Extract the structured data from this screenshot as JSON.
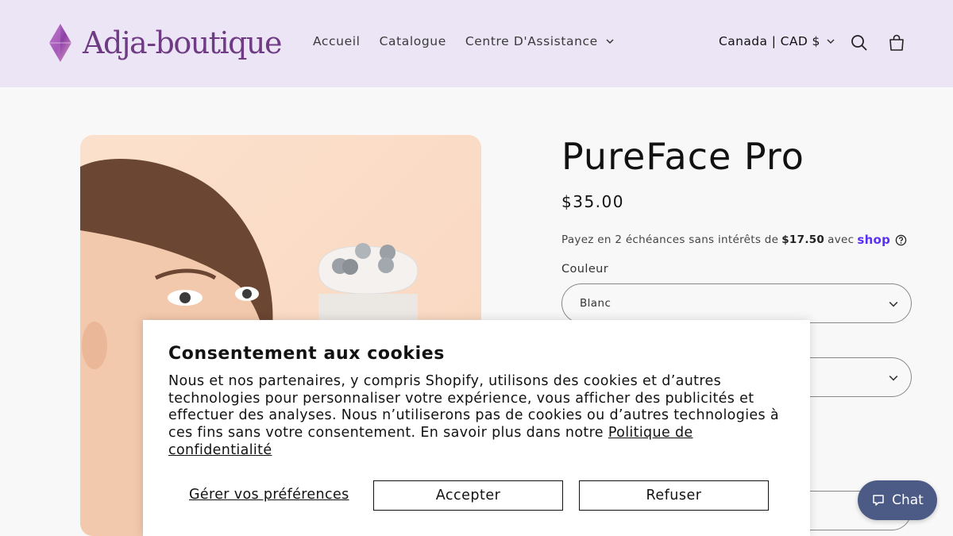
{
  "header": {
    "brand": "Adja-boutique",
    "nav": [
      {
        "label": "Accueil"
      },
      {
        "label": "Catalogue"
      },
      {
        "label": "Centre D'Assistance"
      }
    ],
    "country_selector": "Canada | CAD $",
    "icons": {
      "search": "search-icon",
      "cart": "cart-icon",
      "logo": "diamond-logo-icon"
    }
  },
  "product": {
    "title": "PureFace Pro",
    "price": "$35.00",
    "installments": {
      "prefix": "Payez en 2 échéances sans intérêts de",
      "amount": "$17.50",
      "suffix": "avec",
      "provider": "shop"
    },
    "color_label": "Couleur",
    "color_value": "Blanc"
  },
  "cookie_banner": {
    "title": "Consentement aux cookies",
    "body": "Nous et nos partenaires, y compris Shopify, utilisons des cookies et d’autres technologies pour personnaliser votre expérience, vous afficher des publicités et effectuer des analyses. Nous n’utiliserons pas de cookies ou d’autres technologies à ces fins sans votre consentement. En savoir plus dans notre",
    "link": "Politique de confidentialité",
    "manage": "Gérer vos préférences",
    "accept": "Accepter",
    "decline": "Refuser"
  },
  "chat": {
    "label": "Chat"
  },
  "colors": {
    "header_bg": "#ece5f6",
    "brand": "#6e3b84",
    "shop_pay": "#5a31f4",
    "chat_bg": "#4c5a86"
  }
}
